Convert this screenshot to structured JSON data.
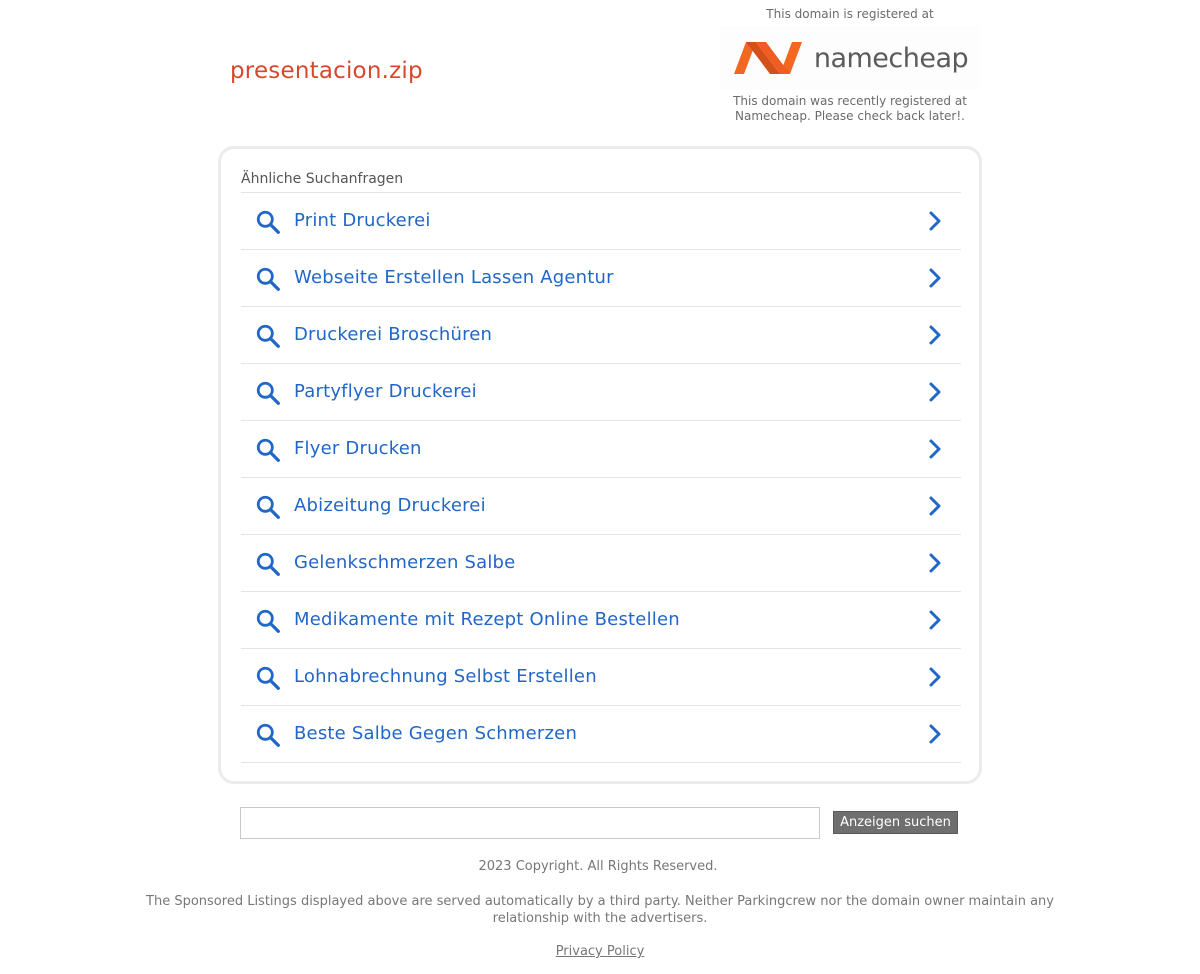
{
  "header": {
    "domain_name": "presentacion.zip"
  },
  "registrar": {
    "top_text": "This domain is registered at",
    "logo_text": "namecheap",
    "bottom_text": "This domain was recently registered at Namecheap. Please check back later!."
  },
  "colors": {
    "domain_title": "#d9472b",
    "result_link": "#2167c7",
    "logo_orange": "#f26722",
    "button_bg": "#6f6f6f"
  },
  "related": {
    "heading": "Ähnliche Suchanfragen",
    "items": [
      {
        "label": "Print Druckerei"
      },
      {
        "label": "Webseite Erstellen Lassen Agentur"
      },
      {
        "label": "Druckerei Broschüren"
      },
      {
        "label": "Partyflyer Druckerei"
      },
      {
        "label": "Flyer Drucken"
      },
      {
        "label": "Abizeitung Druckerei"
      },
      {
        "label": "Gelenkschmerzen Salbe"
      },
      {
        "label": "Medikamente mit Rezept Online Bestellen"
      },
      {
        "label": "Lohnabrechnung Selbst Erstellen"
      },
      {
        "label": "Beste Salbe Gegen Schmerzen"
      }
    ]
  },
  "search": {
    "value": "",
    "button_label": "Anzeigen suchen"
  },
  "footer": {
    "copyright": "2023 Copyright. All Rights Reserved.",
    "disclaimer": "The Sponsored Listings displayed above are served automatically by a third party. Neither Parkingcrew nor the domain owner maintain any relationship with the advertisers.",
    "privacy_label": "Privacy Policy"
  }
}
